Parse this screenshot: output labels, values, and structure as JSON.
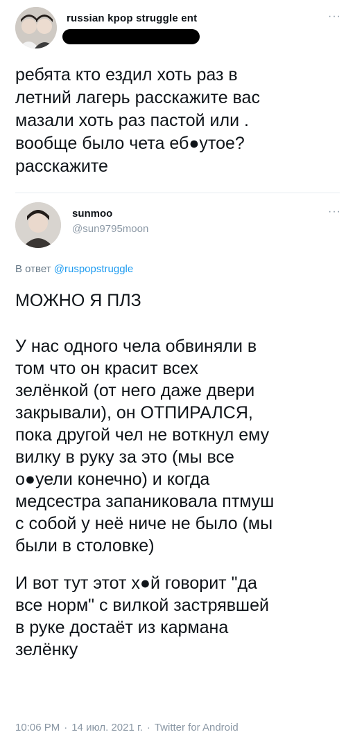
{
  "original": {
    "author_name": "russian kpop struggle ent",
    "more_label": "···",
    "text": "ребята кто ездил хоть раз в\nлетний лагерь расскажите вас\nмазали хоть раз пастой или .\nвообще было чета еб●утое?\nрасскажите"
  },
  "reply": {
    "author_name": "sunmoo",
    "handle": "@sun9795moon",
    "more_label": "···",
    "in_reply_prefix": "В ответ",
    "in_reply_to": "@ruspopstruggle",
    "paragraph_1": "МОЖНО Я ПЛЗ",
    "paragraph_2": "У нас одного чела обвиняли в\nтом что он красит всех\nзелёнкой (от него даже двери\nзакрывали), он ОТПИРАЛСЯ,\nпока другой чел не воткнул ему\nвилку в руку за это (мы все\nо●уели конечно) и когда\nмедсестра запаниковала птмуш\nс собой у неё ниче не было (мы\nбыли в столовке)",
    "paragraph_3": "И вот тут этот х●й говорит \"да\nвсе норм\" с вилкой застрявшей\nв руке достаёт из кармана\nзелёнку"
  },
  "meta": {
    "time": "10:06 PM",
    "date": "14 июл. 2021 г.",
    "source": "Twitter for Android",
    "separator": "·"
  },
  "colors": {
    "text": "#0f1419",
    "secondary": "#8b98a5",
    "link": "#1d9bf0",
    "separator": "#e6ecf0"
  }
}
